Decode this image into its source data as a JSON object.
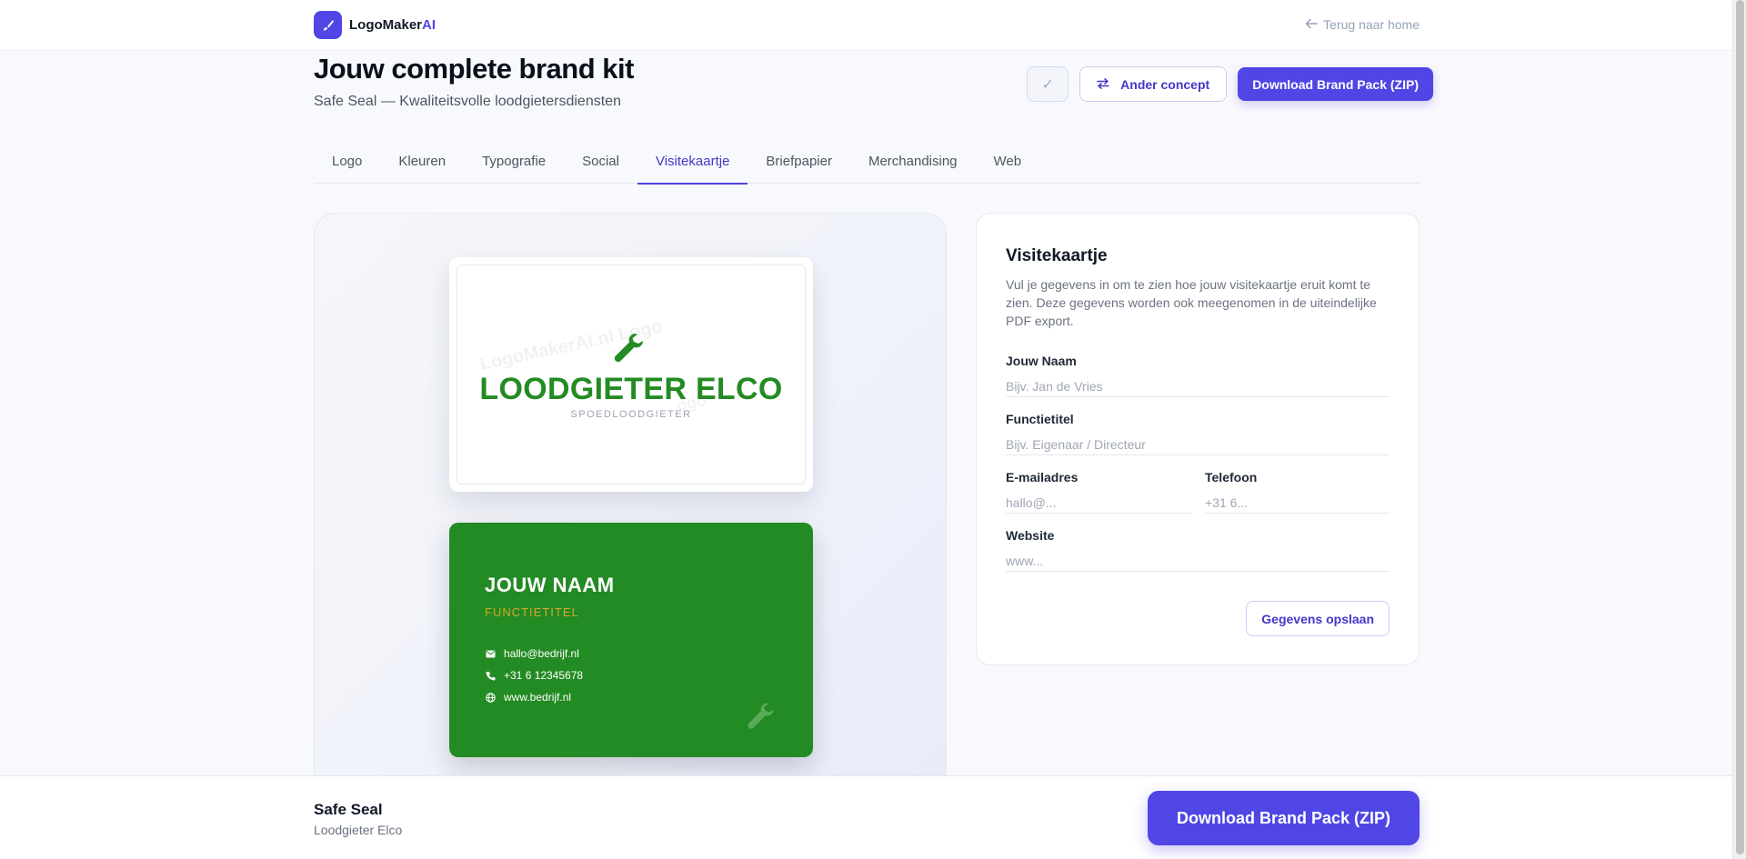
{
  "header": {
    "brand_main": "LogoMaker",
    "brand_accent": "AI",
    "back_link": "Terug naar home"
  },
  "page": {
    "title": "Jouw complete brand kit",
    "subtitle": "Safe Seal — Kwaliteitsvolle loodgietersdiensten"
  },
  "actions": {
    "check_glyph": "✓",
    "other_concept": "Ander concept",
    "download": "Download Brand Pack (ZIP)"
  },
  "tabs": [
    {
      "label": "Logo"
    },
    {
      "label": "Kleuren"
    },
    {
      "label": "Typografie"
    },
    {
      "label": "Social"
    },
    {
      "label": "Visitekaartje",
      "active": true
    },
    {
      "label": "Briefpapier"
    },
    {
      "label": "Merchandising"
    },
    {
      "label": "Web"
    }
  ],
  "card_front": {
    "watermark": "LogoMakerAI.nl Logo",
    "watermark2": "ogo",
    "company": "LOODGIETER ELCO",
    "tagline": "SPOEDLOODGIETER",
    "icon": "wrench-icon",
    "color": "#238b23"
  },
  "card_back": {
    "name": "JOUW NAAM",
    "role": "FUNCTIETITEL",
    "email": "hallo@bedrijf.nl",
    "phone": "+31 6 12345678",
    "website": "www.bedrijf.nl",
    "background": "#238b23",
    "accent": "#d4a72c"
  },
  "form": {
    "title": "Visitekaartje",
    "description": "Vul je gegevens in om te zien hoe jouw visitekaartje eruit komt te zien. Deze gegevens worden ook meegenomen in de uiteindelijke PDF export.",
    "name_label": "Jouw Naam",
    "name_placeholder": "Bijv. Jan de Vries",
    "title_label": "Functietitel",
    "title_placeholder": "Bijv. Eigenaar / Directeur",
    "email_label": "E-mailadres",
    "email_placeholder": "hallo@...",
    "phone_label": "Telefoon",
    "phone_placeholder": "+31 6...",
    "website_label": "Website",
    "website_placeholder": "www...",
    "save": "Gegevens opslaan"
  },
  "footer": {
    "title": "Safe Seal",
    "subtitle": "Loodgieter Elco",
    "download": "Download Brand Pack (ZIP)"
  },
  "colors": {
    "primary": "#4f46e5",
    "brand_green": "#238b23"
  }
}
